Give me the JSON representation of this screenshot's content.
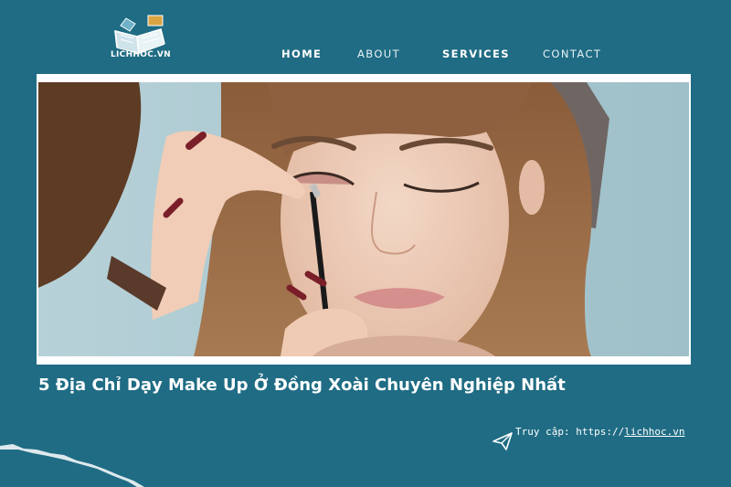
{
  "logo": {
    "text": "LICHHOC.VN",
    "icon": "book-logo-icon"
  },
  "nav": {
    "items": [
      {
        "label": "HOME",
        "active": true
      },
      {
        "label": "ABOUT",
        "active": false
      },
      {
        "label": "SERVICES",
        "active": false
      },
      {
        "label": "CONTACT",
        "active": false
      }
    ]
  },
  "hero": {
    "image": "makeup-artist-applying-eyeshadow-photo"
  },
  "article": {
    "title": "5 Địa Chỉ Dạy Make Up Ở Đồng Xoài Chuyên Nghiệp Nhất"
  },
  "visit": {
    "label": "Truy cập: https://",
    "url": "lichhoc.vn",
    "icon": "paper-plane-icon"
  },
  "colors": {
    "background": "#1f6c84",
    "text": "#ffffff",
    "photo_frame": "#ffffff"
  }
}
